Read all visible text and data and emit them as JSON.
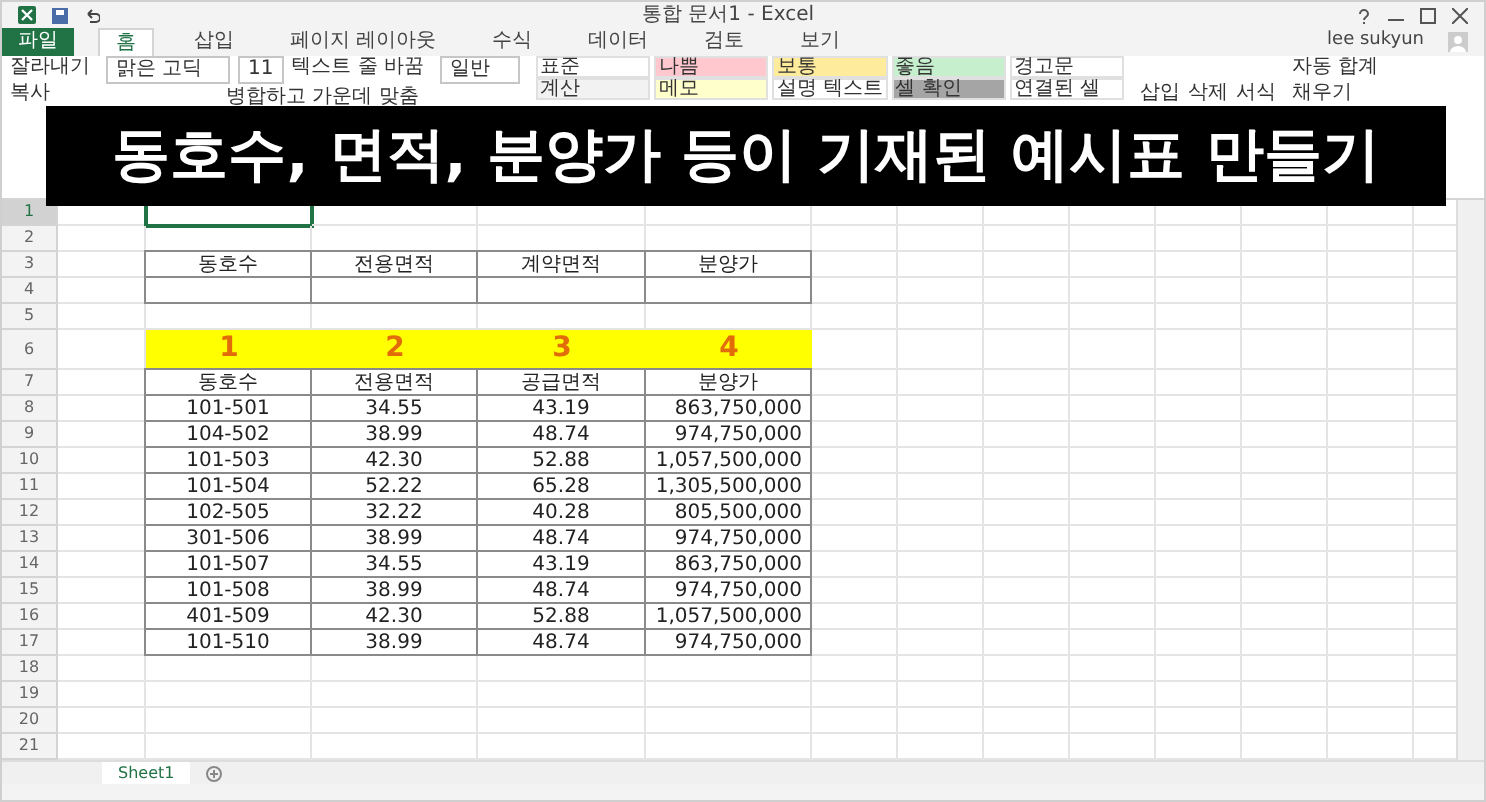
{
  "window": {
    "title": "통합 문서1 - Excel",
    "user": "lee sukyun"
  },
  "file_button": "파일",
  "ribbon_tabs": [
    {
      "label": "홈",
      "selected": true,
      "kind": "tab"
    },
    {
      "label": "삽입",
      "selected": false,
      "kind": "tab"
    },
    {
      "label": "페이지 레이아웃",
      "selected": false,
      "kind": "tab"
    },
    {
      "label": "수식",
      "selected": false,
      "kind": "tab"
    },
    {
      "label": "데이터",
      "selected": false,
      "kind": "tab"
    },
    {
      "label": "검토",
      "selected": false,
      "kind": "tab"
    },
    {
      "label": "보기",
      "selected": false,
      "kind": "tab"
    }
  ],
  "ribbon": {
    "row_1": [
      "잘라내기",
      "맑은 고딕",
      "11",
      "텍스트 줄 바꿈",
      "일반"
    ],
    "row_2": [
      "복사",
      "병합하고 가운데 맞춤"
    ],
    "styles": [
      {
        "label": "표준",
        "color": "#ffffff"
      },
      {
        "label": "나쁨",
        "color": "#ffc7ce"
      },
      {
        "label": "보통",
        "color": "#ffeb9c"
      },
      {
        "label": "좋음",
        "color": "#c6efce"
      },
      {
        "label": "경고문",
        "color": "#ffffff"
      },
      {
        "label": "계산",
        "color": "#f2f2f2"
      },
      {
        "label": "메모",
        "color": "#ffffcc"
      },
      {
        "label": "설명 텍스트",
        "color": "#ffffff"
      },
      {
        "label": "셀 확인",
        "color": "#a5a5a5"
      },
      {
        "label": "연결된 셀",
        "color": "#ffffff"
      }
    ],
    "cells_group": [
      "삽입",
      "삭제",
      "서식"
    ],
    "editing": [
      "자동 합계",
      "채우기"
    ]
  },
  "banner": "동호수, 면적, 분양가 등이 기재된 예시표 만들기",
  "row_headers": [
    {
      "label": "1",
      "selected": true
    },
    {
      "label": "2",
      "selected": false
    },
    {
      "label": "3",
      "selected": false
    },
    {
      "label": "4",
      "selected": false
    },
    {
      "label": "5",
      "selected": false
    },
    {
      "label": "6",
      "selected": false
    },
    {
      "label": "7",
      "selected": false
    },
    {
      "label": "8",
      "selected": false
    },
    {
      "label": "9",
      "selected": false
    },
    {
      "label": "10",
      "selected": false
    },
    {
      "label": "11",
      "selected": false
    },
    {
      "label": "12",
      "selected": false
    },
    {
      "label": "13",
      "selected": false
    },
    {
      "label": "14",
      "selected": false
    },
    {
      "label": "15",
      "selected": false
    },
    {
      "label": "16",
      "selected": false
    },
    {
      "label": "17",
      "selected": false
    },
    {
      "label": "18",
      "selected": false
    },
    {
      "label": "19",
      "selected": false
    },
    {
      "label": "20",
      "selected": false
    },
    {
      "label": "21",
      "selected": false
    }
  ],
  "search_table": {
    "columns": [
      "동호수",
      "전용면적",
      "계약면적",
      "분양가"
    ]
  },
  "numbers_row": [
    "1",
    "2",
    "3",
    "4"
  ],
  "table": {
    "columns": [
      "동호수",
      "전용면적",
      "공급면적",
      "분양가"
    ],
    "rows": [
      [
        "101-501",
        "34.55",
        "43.19",
        "863,750,000"
      ],
      [
        "104-502",
        "38.99",
        "48.74",
        "974,750,000"
      ],
      [
        "101-503",
        "42.30",
        "52.88",
        "1,057,500,000"
      ],
      [
        "101-504",
        "52.22",
        "65.28",
        "1,305,500,000"
      ],
      [
        "102-505",
        "32.22",
        "40.28",
        "805,500,000"
      ],
      [
        "301-506",
        "38.99",
        "48.74",
        "974,750,000"
      ],
      [
        "101-507",
        "34.55",
        "43.19",
        "863,750,000"
      ],
      [
        "101-508",
        "38.99",
        "48.74",
        "974,750,000"
      ],
      [
        "401-509",
        "42.30",
        "52.88",
        "1,057,500,000"
      ],
      [
        "101-510",
        "38.99",
        "48.74",
        "974,750,000"
      ]
    ]
  },
  "sheet_tabs": [
    {
      "label": "Sheet1",
      "selected": true
    }
  ]
}
